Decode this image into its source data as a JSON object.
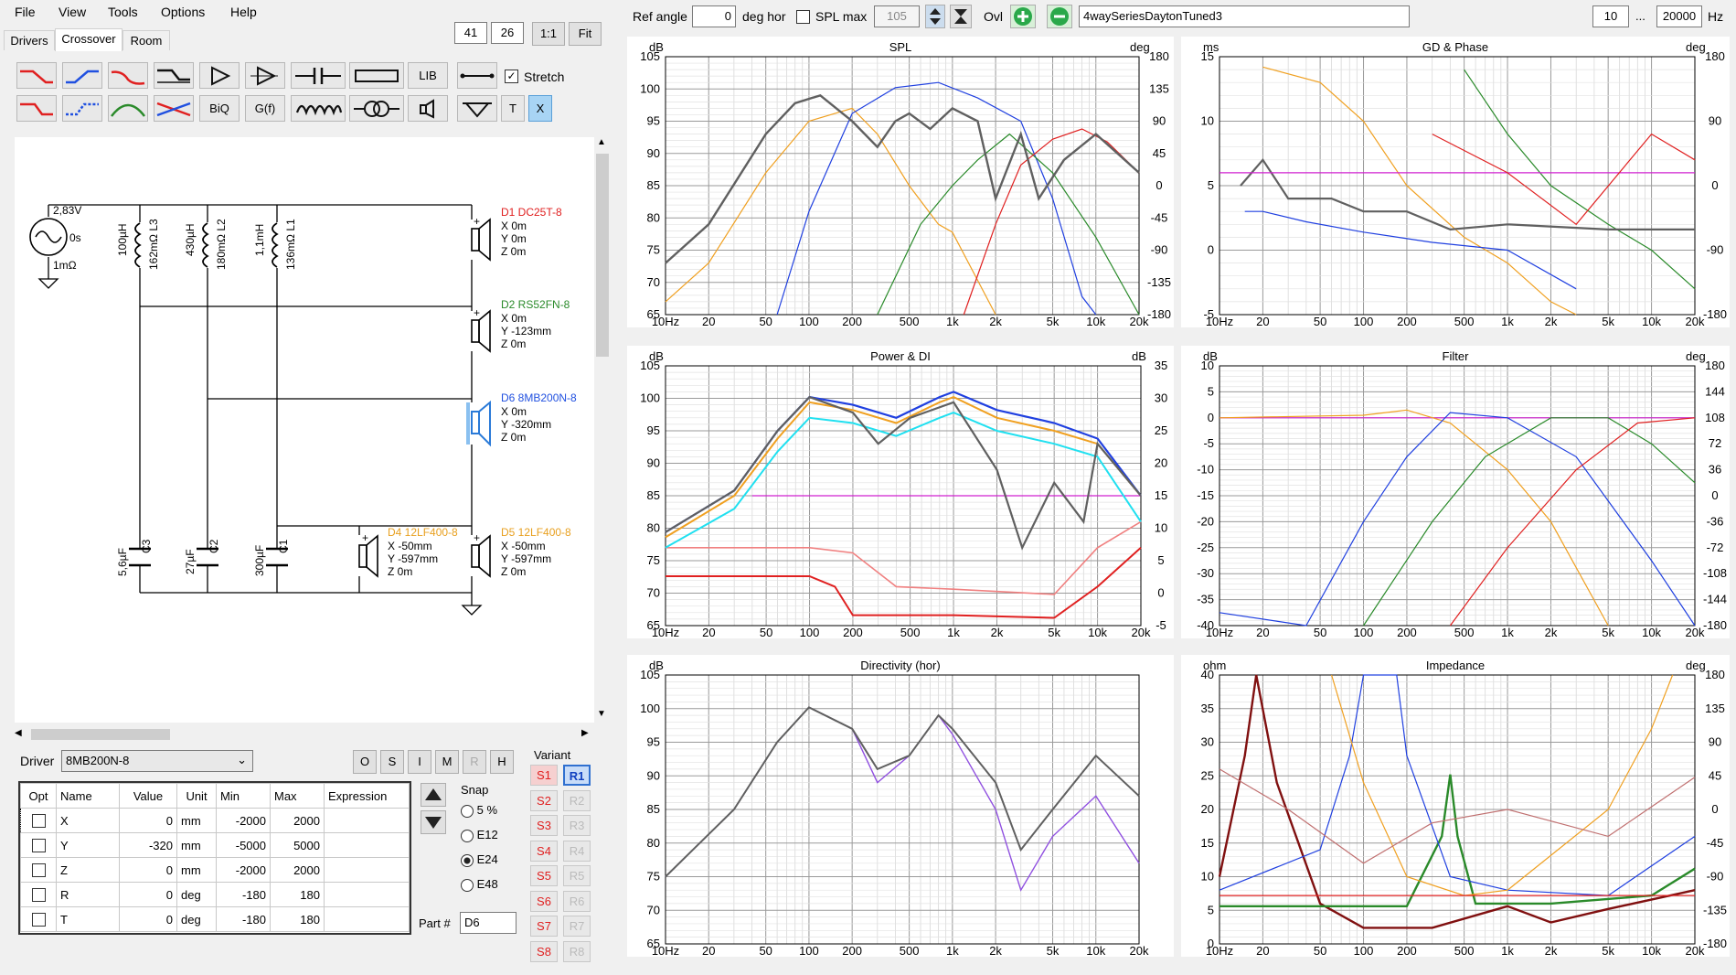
{
  "menu": [
    "File",
    "View",
    "Tools",
    "Options",
    "Help"
  ],
  "tabs": [
    "Drivers",
    "Crossover",
    "Room"
  ],
  "top_left_fields": {
    "v1": "41",
    "v2": "26",
    "b1": "1:1",
    "b2": "Fit"
  },
  "toolbar": {
    "ref_angle_label": "Ref angle",
    "ref_angle_value": "0",
    "deg_hor": "deg hor",
    "spl_max_label": "SPL max",
    "spl_max_value": "105",
    "ovl": "Ovl",
    "project_name": "4waySeriesDaytonTuned3",
    "freq_low": "10",
    "dots": "...",
    "freq_high": "20000",
    "hz": "Hz"
  },
  "crossover_toolbar": {
    "lib": "LIB",
    "stretch": "Stretch",
    "biq": "BiQ",
    "gf": "G(f)",
    "t": "T",
    "x": "X"
  },
  "schematic": {
    "source": {
      "voltage": "2,83V",
      "time": "0s",
      "res": "1mΩ"
    },
    "L3": {
      "value": "100µH",
      "res": "162mΩ L3"
    },
    "L2": {
      "value": "430µH",
      "res": "180mΩ L2"
    },
    "L1": {
      "value": "1,1mH",
      "res": "136mΩ L1"
    },
    "C3": "5,6µF",
    "C2": "27µF",
    "C1": "300µF",
    "C3_name": "C3",
    "C2_name": "C2",
    "C1_name": "C1",
    "drivers": [
      {
        "name": "D1 DC25T-8",
        "color": "#e02020",
        "x": "X 0m",
        "y": "Y 0m",
        "z": "Z 0m"
      },
      {
        "name": "D2 RS52FN-8",
        "color": "#2a8a2a",
        "x": "X 0m",
        "y": "Y -123mm",
        "z": "Z 0m"
      },
      {
        "name": "D6 8MB200N-8",
        "color": "#2050e0",
        "x": "X 0m",
        "y": "Y -320mm",
        "z": "Z 0m"
      },
      {
        "name": "D4 12LF400-8",
        "color": "#e8a020",
        "x": "X -50mm",
        "y": "Y -597mm",
        "z": "Z 0m"
      },
      {
        "name": "D5 12LF400-8",
        "color": "#e8a020",
        "x": "X -50mm",
        "y": "Y -597mm",
        "z": "Z 0m"
      }
    ]
  },
  "driver_bar": {
    "label": "Driver",
    "selected": "8MB200N-8",
    "buttons": [
      "O",
      "S",
      "I",
      "M",
      "R",
      "H"
    ]
  },
  "param_table": {
    "headers": [
      "Opt",
      "Name",
      "Value",
      "Unit",
      "Min",
      "Max",
      "Expression"
    ],
    "rows": [
      {
        "name": "X",
        "value": "0",
        "unit": "mm",
        "min": "-2000",
        "max": "2000"
      },
      {
        "name": "Y",
        "value": "-320",
        "unit": "mm",
        "min": "-5000",
        "max": "5000"
      },
      {
        "name": "Z",
        "value": "0",
        "unit": "mm",
        "min": "-2000",
        "max": "2000"
      },
      {
        "name": "R",
        "value": "0",
        "unit": "deg",
        "min": "-180",
        "max": "180"
      },
      {
        "name": "T",
        "value": "0",
        "unit": "deg",
        "min": "-180",
        "max": "180"
      }
    ]
  },
  "snap": {
    "label": "Snap",
    "options": [
      "5 %",
      "E12",
      "E24",
      "E48"
    ],
    "selected": "E24"
  },
  "part": {
    "label": "Part #",
    "value": "D6"
  },
  "variant": {
    "label": "Variant",
    "s": [
      "S1",
      "S2",
      "S3",
      "S4",
      "S5",
      "S6",
      "S7",
      "S8"
    ],
    "r": [
      "R1",
      "R2",
      "R3",
      "R4",
      "R5",
      "R6",
      "R7",
      "R8"
    ]
  },
  "graphs": {
    "spl": {
      "title": "SPL",
      "left_unit": "dB",
      "right_unit": "deg",
      "left_ticks": [
        "105",
        "100",
        "95",
        "90",
        "85",
        "80",
        "75",
        "70",
        "65"
      ],
      "right_ticks": [
        "180",
        "135",
        "90",
        "45",
        "0",
        "-45",
        "-90",
        "-135",
        "-180"
      ]
    },
    "gd": {
      "title": "GD & Phase",
      "left_unit": "ms",
      "right_unit": "deg",
      "left_ticks": [
        "15",
        "10",
        "5",
        "0",
        "-5"
      ],
      "right_ticks": [
        "180",
        "90",
        "0",
        "-90",
        "-180"
      ]
    },
    "power": {
      "title": "Power & DI",
      "left_unit": "dB",
      "right_unit": "dB",
      "left_ticks": [
        "105",
        "100",
        "95",
        "90",
        "85",
        "80",
        "75",
        "70",
        "65"
      ],
      "right_ticks": [
        "35",
        "30",
        "25",
        "20",
        "15",
        "10",
        "5",
        "0",
        "-5"
      ]
    },
    "filter": {
      "title": "Filter",
      "left_unit": "dB",
      "right_unit": "deg",
      "left_ticks": [
        "10",
        "5",
        "0",
        "-5",
        "-10",
        "-15",
        "-20",
        "-25",
        "-30",
        "-35",
        "-40"
      ],
      "right_ticks": [
        "180",
        "144",
        "108",
        "72",
        "36",
        "0",
        "-36",
        "-72",
        "-108",
        "-144",
        "-180"
      ]
    },
    "directivity": {
      "title": "Directivity (hor)",
      "left_unit": "dB",
      "left_ticks": [
        "105",
        "100",
        "95",
        "90",
        "85",
        "80",
        "75",
        "70",
        "65"
      ]
    },
    "impedance": {
      "title": "Impedance",
      "left_unit": "ohm",
      "right_unit": "deg",
      "left_ticks": [
        "40",
        "35",
        "30",
        "25",
        "20",
        "15",
        "10",
        "5",
        "0"
      ],
      "right_ticks": [
        "180",
        "135",
        "90",
        "45",
        "0",
        "-45",
        "-90",
        "-135",
        "-180"
      ]
    },
    "x_ticks": [
      "10Hz",
      "20",
      "50",
      "100",
      "200",
      "500",
      "1k",
      "2k",
      "5k",
      "10k",
      "20k"
    ]
  },
  "colors": {
    "red": "#e02020",
    "green": "#2a8a2a",
    "blue": "#2040e0",
    "orange": "#f0a020",
    "gray": "#606060",
    "magenta": "#d020d0",
    "cyan": "#20e0f0",
    "darkred": "#801010"
  }
}
